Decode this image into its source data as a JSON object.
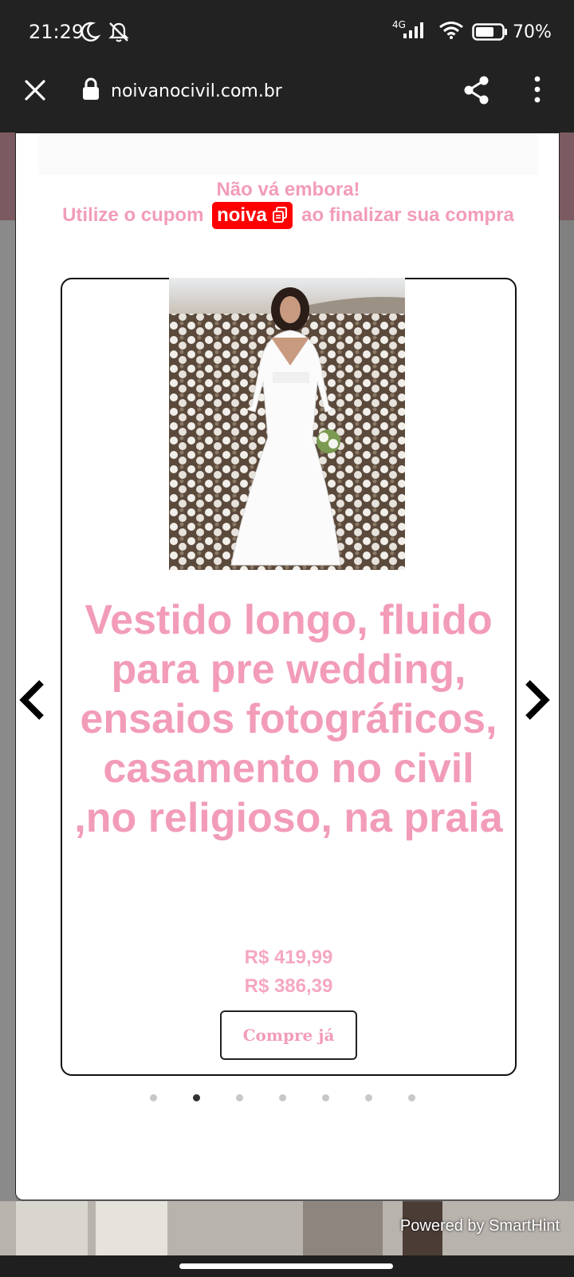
{
  "status_bar": {
    "time": "21:29",
    "network": "4G",
    "battery": "70%"
  },
  "browser": {
    "url": "noivanocivil.com.br"
  },
  "popup": {
    "heading": "Não vá embora!",
    "coupon_prefix": "Utilize o cupom",
    "coupon_code": "noiva",
    "coupon_suffix": "ao finalizar sua compra"
  },
  "product": {
    "title": "Vestido longo, fluido para pre wedding, ensaios fotográficos, casamento no civil ,no religioso, na praia",
    "price_original": "R$ 419,99",
    "price_sale": "R$ 386,39",
    "buy_label": "Compre já"
  },
  "carousel": {
    "total_slides": 7,
    "active_index": 1
  },
  "footer": {
    "powered_by": "Powered by SmartHint"
  },
  "colors": {
    "accent_pink": "#f29cb8",
    "coupon_red": "#ff0000",
    "chrome": "#222222"
  }
}
